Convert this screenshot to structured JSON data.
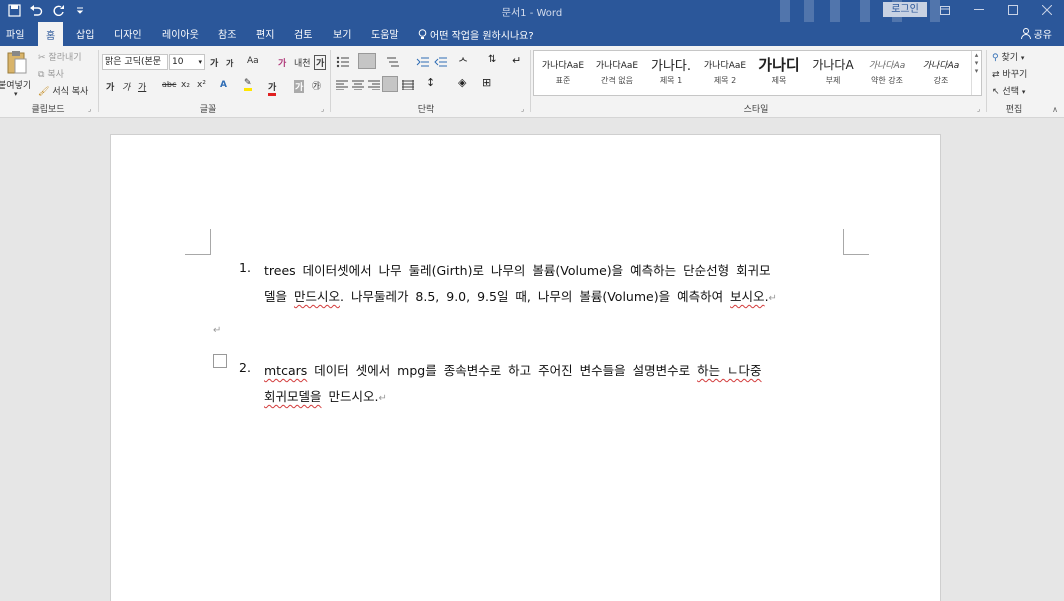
{
  "titlebar": {
    "title": "문서1 - Word",
    "login_label": "로그인"
  },
  "tabs": [
    "파일",
    "홈",
    "삽입",
    "디자인",
    "레이아웃",
    "참조",
    "편지",
    "검토",
    "보기",
    "도움말"
  ],
  "active_tab": "홈",
  "tell_me": "어떤 작업을 원하시나요?",
  "share_label": "공유",
  "ribbon": {
    "clipboard": {
      "paste": "붙여넣기",
      "cut": "잘라내기",
      "copy": "복사",
      "format_painter": "서식 복사",
      "label": "클립보드"
    },
    "font": {
      "font_name": "맑은 고딕(본문",
      "font_size": "10",
      "grow": "가",
      "shrink": "가",
      "change_case": "Aa",
      "clear_format": "가",
      "phonetic": "내천",
      "char_border": "가",
      "bold": "가",
      "italic": "가",
      "underline": "가",
      "strike": "abc",
      "subscript": "x₂",
      "superscript": "x²",
      "font_color": "가",
      "char_shading": "가",
      "enclose": "㉮",
      "label": "글꼴"
    },
    "paragraph": {
      "label": "단락"
    },
    "styles": {
      "items": [
        {
          "sample": "가나다AaE",
          "name": "표준"
        },
        {
          "sample": "가나다AaE",
          "name": "간격 없음"
        },
        {
          "sample": "가나다.",
          "name": "제목 1"
        },
        {
          "sample": "가나다AaE",
          "name": "제목 2"
        },
        {
          "sample": "가나디",
          "name": "제목"
        },
        {
          "sample": "가나다A",
          "name": "부제"
        },
        {
          "sample": "가나다Aa",
          "name": "약한 강조"
        },
        {
          "sample": "가나다Aa",
          "name": "강조"
        }
      ],
      "label": "스타일"
    },
    "editing": {
      "find": "찾기",
      "replace": "바꾸기",
      "select": "선택",
      "label": "편집"
    }
  },
  "document": {
    "item1": {
      "number": "1.",
      "line1": "trees 데이터셋에서 나무 둘레(Girth)로 나무의 볼륨(Volume)을 예측하는 단순선형 회귀모",
      "line2_a": "델을 ",
      "line2_b": "만드시오",
      "line2_c": ". 나무둘레가 8.5, 9.0, 9.5일 때, 나무의 볼륨(Volume)을 예측하여 ",
      "line2_d": "보시오",
      "line2_e": "."
    },
    "item2": {
      "number": "2.",
      "line1_a": "mtcars",
      "line1_b": " 데이터 셋에서 mpg를 종속변수로 하고 주어진 변수들을 설명변수로 ",
      "line1_c": "하는 ㄴ다중",
      "line2_a": "회귀모델을",
      "line2_b": " 만드시오."
    }
  }
}
